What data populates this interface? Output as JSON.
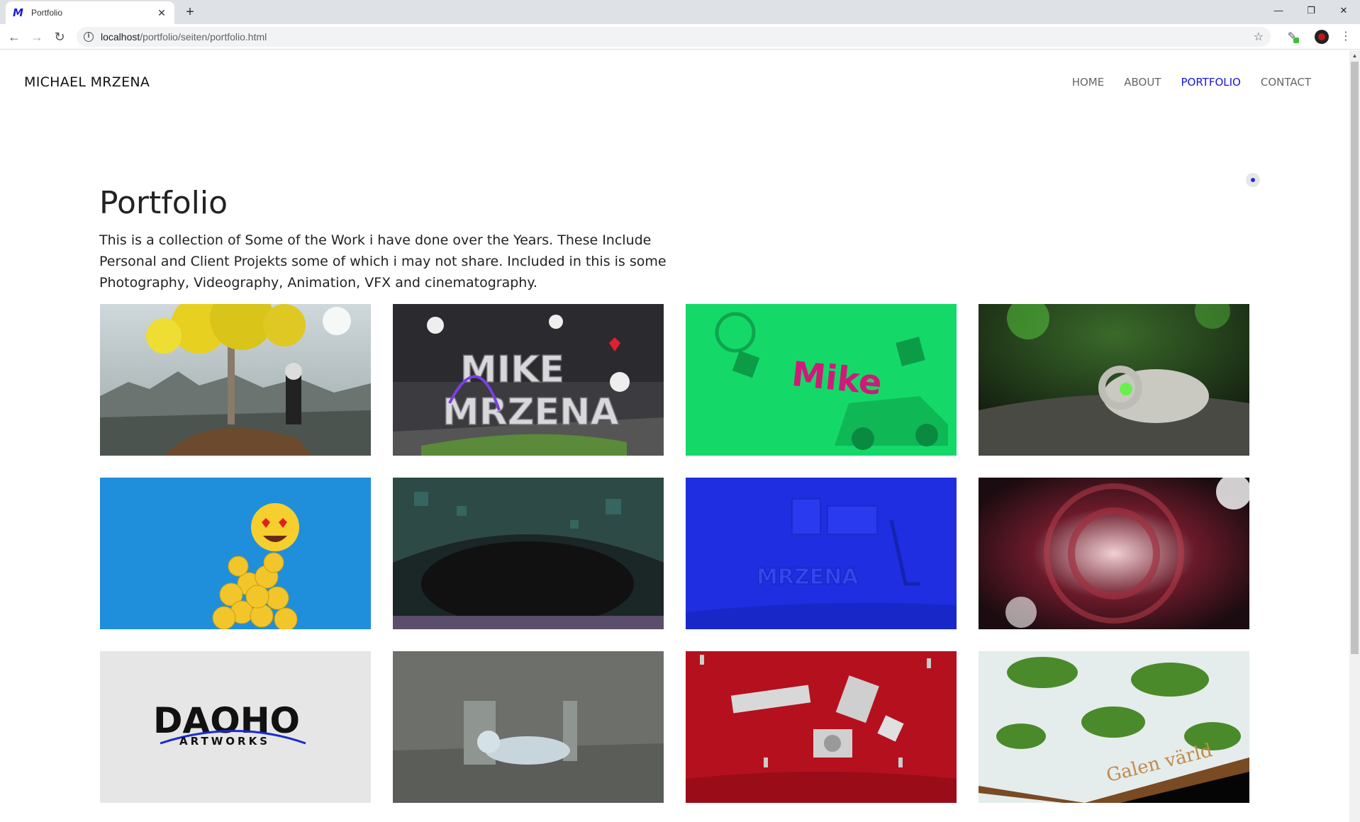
{
  "browser": {
    "tab_title": "Portfolio",
    "new_tab": "+",
    "url_host": "localhost",
    "url_path": "/portfolio/seiten/portfolio.html",
    "window_controls": [
      "—",
      "❐",
      "✕"
    ]
  },
  "site": {
    "brand": "MICHAEL MRZENA",
    "nav": [
      {
        "label": "HOME",
        "active": false
      },
      {
        "label": "ABOUT",
        "active": false
      },
      {
        "label": "PORTFOLIO",
        "active": true
      },
      {
        "label": "CONTACT",
        "active": false
      }
    ],
    "accent_color": "#1515d6"
  },
  "main": {
    "title": "Portfolio",
    "intro": "This is a collection of Some of the Work i have done over the Years. These Include Personal and Client Projekts some of which i may not share. Included in this is some Photography, Videography, Animation, VFX and cinematography."
  },
  "gallery": [
    {
      "subject": "astronaut-under-yellow-tree"
    },
    {
      "subject": "mike-mrzena-3d-letters"
    },
    {
      "subject": "green-mike-car-scene"
    },
    {
      "subject": "glowing-skull"
    },
    {
      "subject": "yellow-ball-emoji-figure"
    },
    {
      "subject": "dark-fractal-cave"
    },
    {
      "subject": "blue-desk-scene"
    },
    {
      "subject": "red-glass-tunnel"
    },
    {
      "subject": "daoho-artworks-logo",
      "logo_text": "DAOHO",
      "logo_sub": "ARTWORKS"
    },
    {
      "subject": "grey-sleeping-figure"
    },
    {
      "subject": "red-flying-devices"
    },
    {
      "subject": "galen-varld-terrain",
      "engraving": "Galen värld"
    }
  ]
}
